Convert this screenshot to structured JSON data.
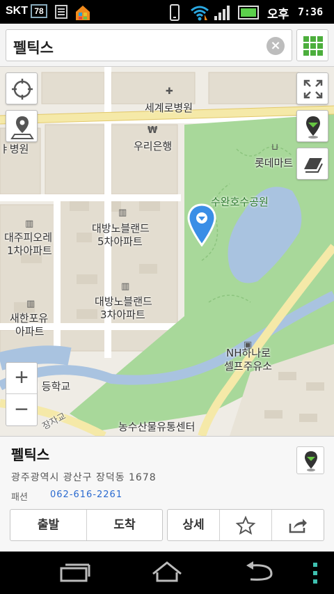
{
  "status_bar": {
    "carrier": "SKT",
    "badge": "78",
    "ampm": "오후",
    "time": "7:36"
  },
  "search": {
    "query": "펠틱스",
    "clear_label": "×"
  },
  "map_labels": {
    "hospital": "세계로병원",
    "hospital_left": "ㅑ병원",
    "bank": "우리은행",
    "lotte": "롯데마트",
    "park": "수완호수공원",
    "apt1_l1": "대방노블랜드",
    "apt1_l2": "5차아파트",
    "apt2_l1": "대주피오레",
    "apt2_l2": "1차아파트",
    "apt3_l1": "대방노블랜드",
    "apt3_l2": "3차아파트",
    "apt4_l1": "새한포유",
    "apt4_l2": "아파트",
    "gas_l1": "NH하나로",
    "gas_l2": "셀프주유소",
    "school": "ㅣ등학교",
    "bridge": "장자교",
    "market": "농수산물유통센터"
  },
  "zoom": {
    "in": "+",
    "out": "−"
  },
  "place": {
    "name": "펠틱스",
    "address": "광주광역시 광산구 장덕동 1678",
    "category": "패션",
    "phone": "062-616-2261"
  },
  "actions": {
    "depart": "출발",
    "arrive": "도착",
    "detail": "상세"
  },
  "colors": {
    "park_green": "#a8d89a",
    "water": "#a9c3e0",
    "road": "#f5e9a8",
    "pin": "#3a8ee6",
    "accent": "#4cae3c"
  }
}
